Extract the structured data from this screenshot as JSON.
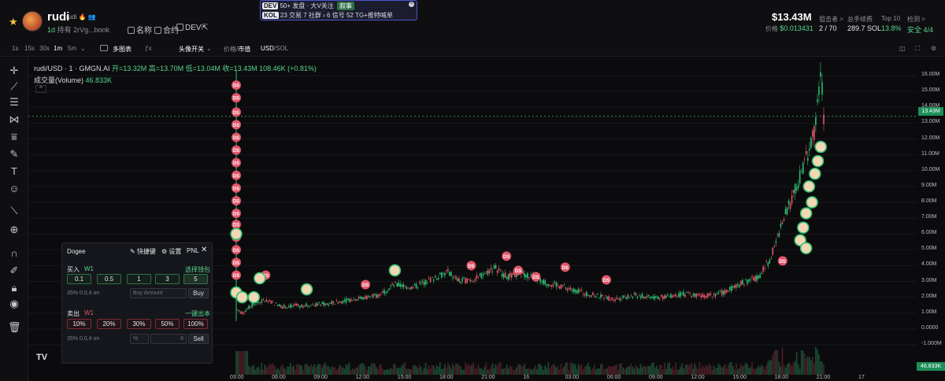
{
  "header": {
    "token_name": "rudi",
    "token_sub": "rudi 🔥 👥",
    "age": "1d",
    "hold_label": "持有",
    "address": "2rVg...bonk",
    "links": [
      {
        "icon": "search-icon",
        "label": "名称"
      },
      {
        "icon": "search-icon",
        "label": "合约"
      },
      {
        "icon": "search-icon",
        "label": "DEV"
      }
    ],
    "market_cap": "$13.43M",
    "price_label": "价格",
    "price": "$0.013431",
    "stats": [
      {
        "label": "狙击者 >",
        "value": "2 / 70"
      },
      {
        "label": "总手续费",
        "value": "289.7 SOL"
      },
      {
        "label": "Top 10",
        "value": "13.8%"
      },
      {
        "label": "检测 >",
        "value": "安全 4/4"
      }
    ]
  },
  "popup": {
    "row1": {
      "tag": "DEV",
      "items": [
        "50+ 发盘",
        "大V关注",
        "叙事"
      ]
    },
    "row2": {
      "tag": "KOL",
      "items": [
        "23 交易",
        "7 社群",
        "6 信号",
        "52 TG+推特喊单"
      ]
    }
  },
  "toolbar": {
    "intervals": [
      "1s",
      "15s",
      "30s",
      "1m",
      "5m"
    ],
    "active_interval": "1m",
    "multi_chart": "多图表",
    "avatar_toggle": "头像开关",
    "price_mcap_a": "价格",
    "price_mcap_b": "市值",
    "currency_a": "USD",
    "currency_b": "SOL"
  },
  "legend": {
    "symbol": "rudi/USD · 1 · GMGN.AI",
    "ohlc": "开=13.32M 高=13.70M 低=13.04M 收=13.43M 108.46K (+0.81%)",
    "volume_label": "成交量(Volume)",
    "volume_value": "46.833K"
  },
  "chart_data": {
    "type": "candlestick",
    "title": "rudi/USD · 1 · GMGN.AI",
    "ylabel": "",
    "y_ticks": [
      "16.00M",
      "15.00M",
      "14.00M",
      "13.00M",
      "12.00M",
      "11.00M",
      "10.00M",
      "9.00M",
      "8.00M",
      "7.00M",
      "6.00M",
      "5.00M",
      "4.00M",
      "3.00M",
      "2.00M",
      "1.00M",
      "0.0000",
      "-1.000M"
    ],
    "ylim": [
      -1.3,
      16.6
    ],
    "x_ticks": [
      "03:00",
      "06:00",
      "09:00",
      "12:00",
      "15:00",
      "18:00",
      "21:00",
      "16",
      "03:00",
      "06:00",
      "09:00",
      "12:00",
      "15:00",
      "18:00",
      "21:00",
      "17"
    ],
    "current_price": "13.43M",
    "current_volume": "46.833K",
    "ohlc": {
      "open": "13.32M",
      "high": "13.70M",
      "low": "13.04M",
      "close": "13.43M",
      "change": "108.46K (+0.81%)"
    },
    "trend": [
      {
        "t": 0.0,
        "v": 1.3
      },
      {
        "t": 0.01,
        "v": 1.0
      },
      {
        "t": 0.03,
        "v": 1.6
      },
      {
        "t": 0.05,
        "v": 1.8
      },
      {
        "t": 0.08,
        "v": 1.4
      },
      {
        "t": 0.12,
        "v": 1.5
      },
      {
        "t": 0.16,
        "v": 1.6
      },
      {
        "t": 0.2,
        "v": 1.9
      },
      {
        "t": 0.24,
        "v": 2.1
      },
      {
        "t": 0.27,
        "v": 2.8
      },
      {
        "t": 0.3,
        "v": 2.6
      },
      {
        "t": 0.33,
        "v": 3.1
      },
      {
        "t": 0.36,
        "v": 3.6
      },
      {
        "t": 0.38,
        "v": 3.0
      },
      {
        "t": 0.41,
        "v": 3.2
      },
      {
        "t": 0.44,
        "v": 3.9
      },
      {
        "t": 0.46,
        "v": 3.3
      },
      {
        "t": 0.49,
        "v": 3.5
      },
      {
        "t": 0.52,
        "v": 3.0
      },
      {
        "t": 0.56,
        "v": 2.6
      },
      {
        "t": 0.6,
        "v": 2.2
      },
      {
        "t": 0.64,
        "v": 1.9
      },
      {
        "t": 0.68,
        "v": 2.1
      },
      {
        "t": 0.72,
        "v": 2.0
      },
      {
        "t": 0.76,
        "v": 2.2
      },
      {
        "t": 0.8,
        "v": 2.1
      },
      {
        "t": 0.83,
        "v": 2.3
      },
      {
        "t": 0.86,
        "v": 2.9
      },
      {
        "t": 0.89,
        "v": 3.3
      },
      {
        "t": 0.91,
        "v": 4.5
      },
      {
        "t": 0.93,
        "v": 6.8
      },
      {
        "t": 0.95,
        "v": 8.6
      },
      {
        "t": 0.97,
        "v": 10.8
      },
      {
        "t": 0.985,
        "v": 12.6
      },
      {
        "t": 0.995,
        "v": 16.3
      },
      {
        "t": 1.0,
        "v": 13.43
      }
    ],
    "markers_label": "DS"
  },
  "panel": {
    "title": "Dogee",
    "shortcut": "快捷键",
    "settings": "设置",
    "pnl": "PNL",
    "buy_label": "买入",
    "buy_wallet": "W1",
    "select_wallet": "选择钱包",
    "buy_amounts": [
      "0.1",
      "0.5",
      "1",
      "3",
      "5"
    ],
    "buy_meta": "35%  0.0,4  on",
    "buy_placeholder": "Buy Amount",
    "buy_button": "Buy",
    "sell_label": "卖出",
    "sell_wallet": "W1",
    "sell_all": "一键出本",
    "sell_pcts": [
      "10%",
      "20%",
      "30%",
      "50%",
      "100%"
    ],
    "sell_meta": "35%  0.0,4  on",
    "sell_placeholder_a": "%",
    "sell_placeholder_b": "8",
    "sell_button": "Sell"
  }
}
